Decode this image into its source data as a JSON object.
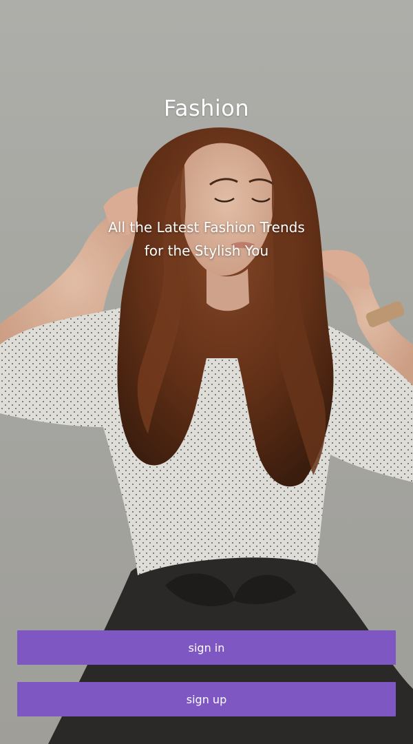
{
  "app": {
    "title": "Fashion",
    "tagline_line1": "All the Latest Fashion Trends",
    "tagline_line2": "for the Stylish You"
  },
  "actions": {
    "sign_in_label": "sign in",
    "sign_up_label": "sign up"
  },
  "colors": {
    "button_background": "#7e57c2",
    "button_text": "#ffffff",
    "title_text": "#ffffff"
  }
}
